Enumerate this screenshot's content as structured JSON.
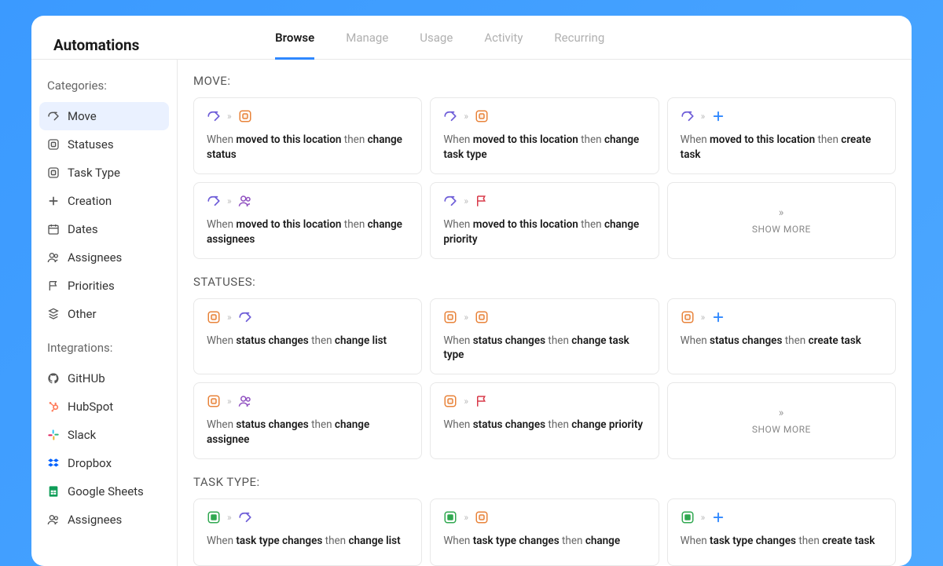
{
  "header": {
    "title": "Automations",
    "tabs": [
      "Browse",
      "Manage",
      "Usage",
      "Activity",
      "Recurring"
    ],
    "activeTab": 0
  },
  "sidebar": {
    "categoriesLabel": "Categories:",
    "categories": [
      {
        "icon": "share",
        "label": "Move",
        "active": true
      },
      {
        "icon": "status",
        "label": "Statuses"
      },
      {
        "icon": "status",
        "label": "Task Type"
      },
      {
        "icon": "plus",
        "label": "Creation"
      },
      {
        "icon": "date",
        "label": "Dates"
      },
      {
        "icon": "people",
        "label": "Assignees"
      },
      {
        "icon": "flag",
        "label": "Priorities"
      },
      {
        "icon": "other",
        "label": "Other"
      }
    ],
    "integrationsLabel": "Integrations:",
    "integrations": [
      {
        "icon": "github",
        "label": "GitHUb"
      },
      {
        "icon": "hubspot",
        "label": "HubSpot"
      },
      {
        "icon": "slack",
        "label": "Slack"
      },
      {
        "icon": "dropbox",
        "label": "Dropbox"
      },
      {
        "icon": "sheets",
        "label": "Google Sheets"
      },
      {
        "icon": "assignees",
        "label": "Assignees"
      }
    ]
  },
  "groups": [
    {
      "title": "MOVE:",
      "cards": [
        {
          "icons": [
            "arrow",
            "chev",
            "status"
          ],
          "text": [
            {
              "t": "When "
            },
            {
              "b": "moved to this location"
            },
            {
              "t": " then "
            },
            {
              "b": "change status"
            }
          ]
        },
        {
          "icons": [
            "arrow",
            "chev",
            "status"
          ],
          "text": [
            {
              "t": "When "
            },
            {
              "b": "moved to this location"
            },
            {
              "t": " then "
            },
            {
              "b": "change task type"
            }
          ]
        },
        {
          "icons": [
            "arrow",
            "chev",
            "plus"
          ],
          "text": [
            {
              "t": "When "
            },
            {
              "b": "moved to this location"
            },
            {
              "t": " then "
            },
            {
              "b": "create task"
            }
          ]
        },
        {
          "icons": [
            "arrow",
            "chev",
            "people"
          ],
          "text": [
            {
              "t": "When "
            },
            {
              "b": "moved to this location"
            },
            {
              "t": " then "
            },
            {
              "b": "change assignees"
            }
          ]
        },
        {
          "icons": [
            "arrow",
            "chev",
            "flag"
          ],
          "text": [
            {
              "t": "When "
            },
            {
              "b": "moved to this location"
            },
            {
              "t": " then "
            },
            {
              "b": "change priority"
            }
          ]
        },
        {
          "showMore": true,
          "label": "SHOW MORE"
        }
      ]
    },
    {
      "title": "STATUSES:",
      "cards": [
        {
          "icons": [
            "status",
            "chev",
            "arrow"
          ],
          "text": [
            {
              "t": "When "
            },
            {
              "b": "status changes"
            },
            {
              "t": " then "
            },
            {
              "b": "change list"
            }
          ]
        },
        {
          "icons": [
            "status",
            "chev",
            "status"
          ],
          "text": [
            {
              "t": "When "
            },
            {
              "b": "status changes"
            },
            {
              "t": " then "
            },
            {
              "b": "change task type"
            }
          ]
        },
        {
          "icons": [
            "status",
            "chev",
            "plus"
          ],
          "text": [
            {
              "t": "When "
            },
            {
              "b": "status changes"
            },
            {
              "t": " then "
            },
            {
              "b": "create task"
            }
          ]
        },
        {
          "icons": [
            "status",
            "chev",
            "people"
          ],
          "text": [
            {
              "t": "When "
            },
            {
              "b": "status changes"
            },
            {
              "t": " then "
            },
            {
              "b": "change assignee"
            }
          ]
        },
        {
          "icons": [
            "status",
            "chev",
            "flag"
          ],
          "text": [
            {
              "t": "When "
            },
            {
              "b": "status changes"
            },
            {
              "t": " then "
            },
            {
              "b": "change priority"
            }
          ]
        },
        {
          "showMore": true,
          "label": "SHOW MORE"
        }
      ]
    },
    {
      "title": "TASK TYPE:",
      "cards": [
        {
          "icons": [
            "tasktype",
            "chev",
            "arrow"
          ],
          "text": [
            {
              "t": "When "
            },
            {
              "b": "task type changes"
            },
            {
              "t": " then "
            },
            {
              "b": "change list"
            }
          ]
        },
        {
          "icons": [
            "tasktype",
            "chev",
            "status"
          ],
          "text": [
            {
              "t": "When "
            },
            {
              "b": "task type changes"
            },
            {
              "t": " then "
            },
            {
              "b": "change"
            }
          ]
        },
        {
          "icons": [
            "tasktype",
            "chev",
            "plus"
          ],
          "text": [
            {
              "t": "When "
            },
            {
              "b": "task type changes"
            },
            {
              "t": " then "
            },
            {
              "b": "create task"
            }
          ]
        }
      ]
    }
  ]
}
